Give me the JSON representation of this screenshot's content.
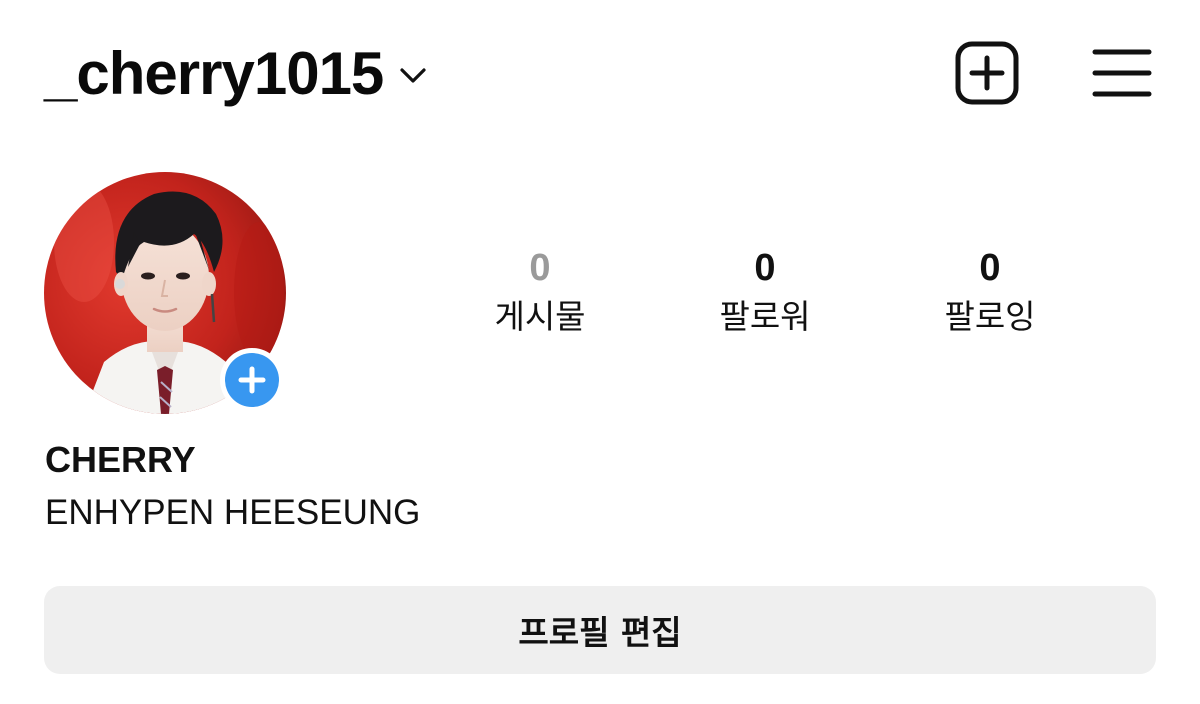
{
  "header": {
    "username": "_cherry1015",
    "icons": {
      "account_switch": "chevron-down-icon",
      "new_post": "plus-square-icon",
      "menu": "hamburger-menu-icon"
    }
  },
  "profile": {
    "avatar_icon": "profile-photo",
    "add_story_icon": "plus-circle-icon",
    "accent_color": "#3897f0",
    "display_name": "CHERRY",
    "bio": "ENHYPEN HEESEUNG"
  },
  "stats": {
    "posts": {
      "count": "0",
      "label": "게시물"
    },
    "followers": {
      "count": "0",
      "label": "팔로워"
    },
    "following": {
      "count": "0",
      "label": "팔로잉"
    }
  },
  "actions": {
    "edit_profile_label": "프로필 편집"
  }
}
